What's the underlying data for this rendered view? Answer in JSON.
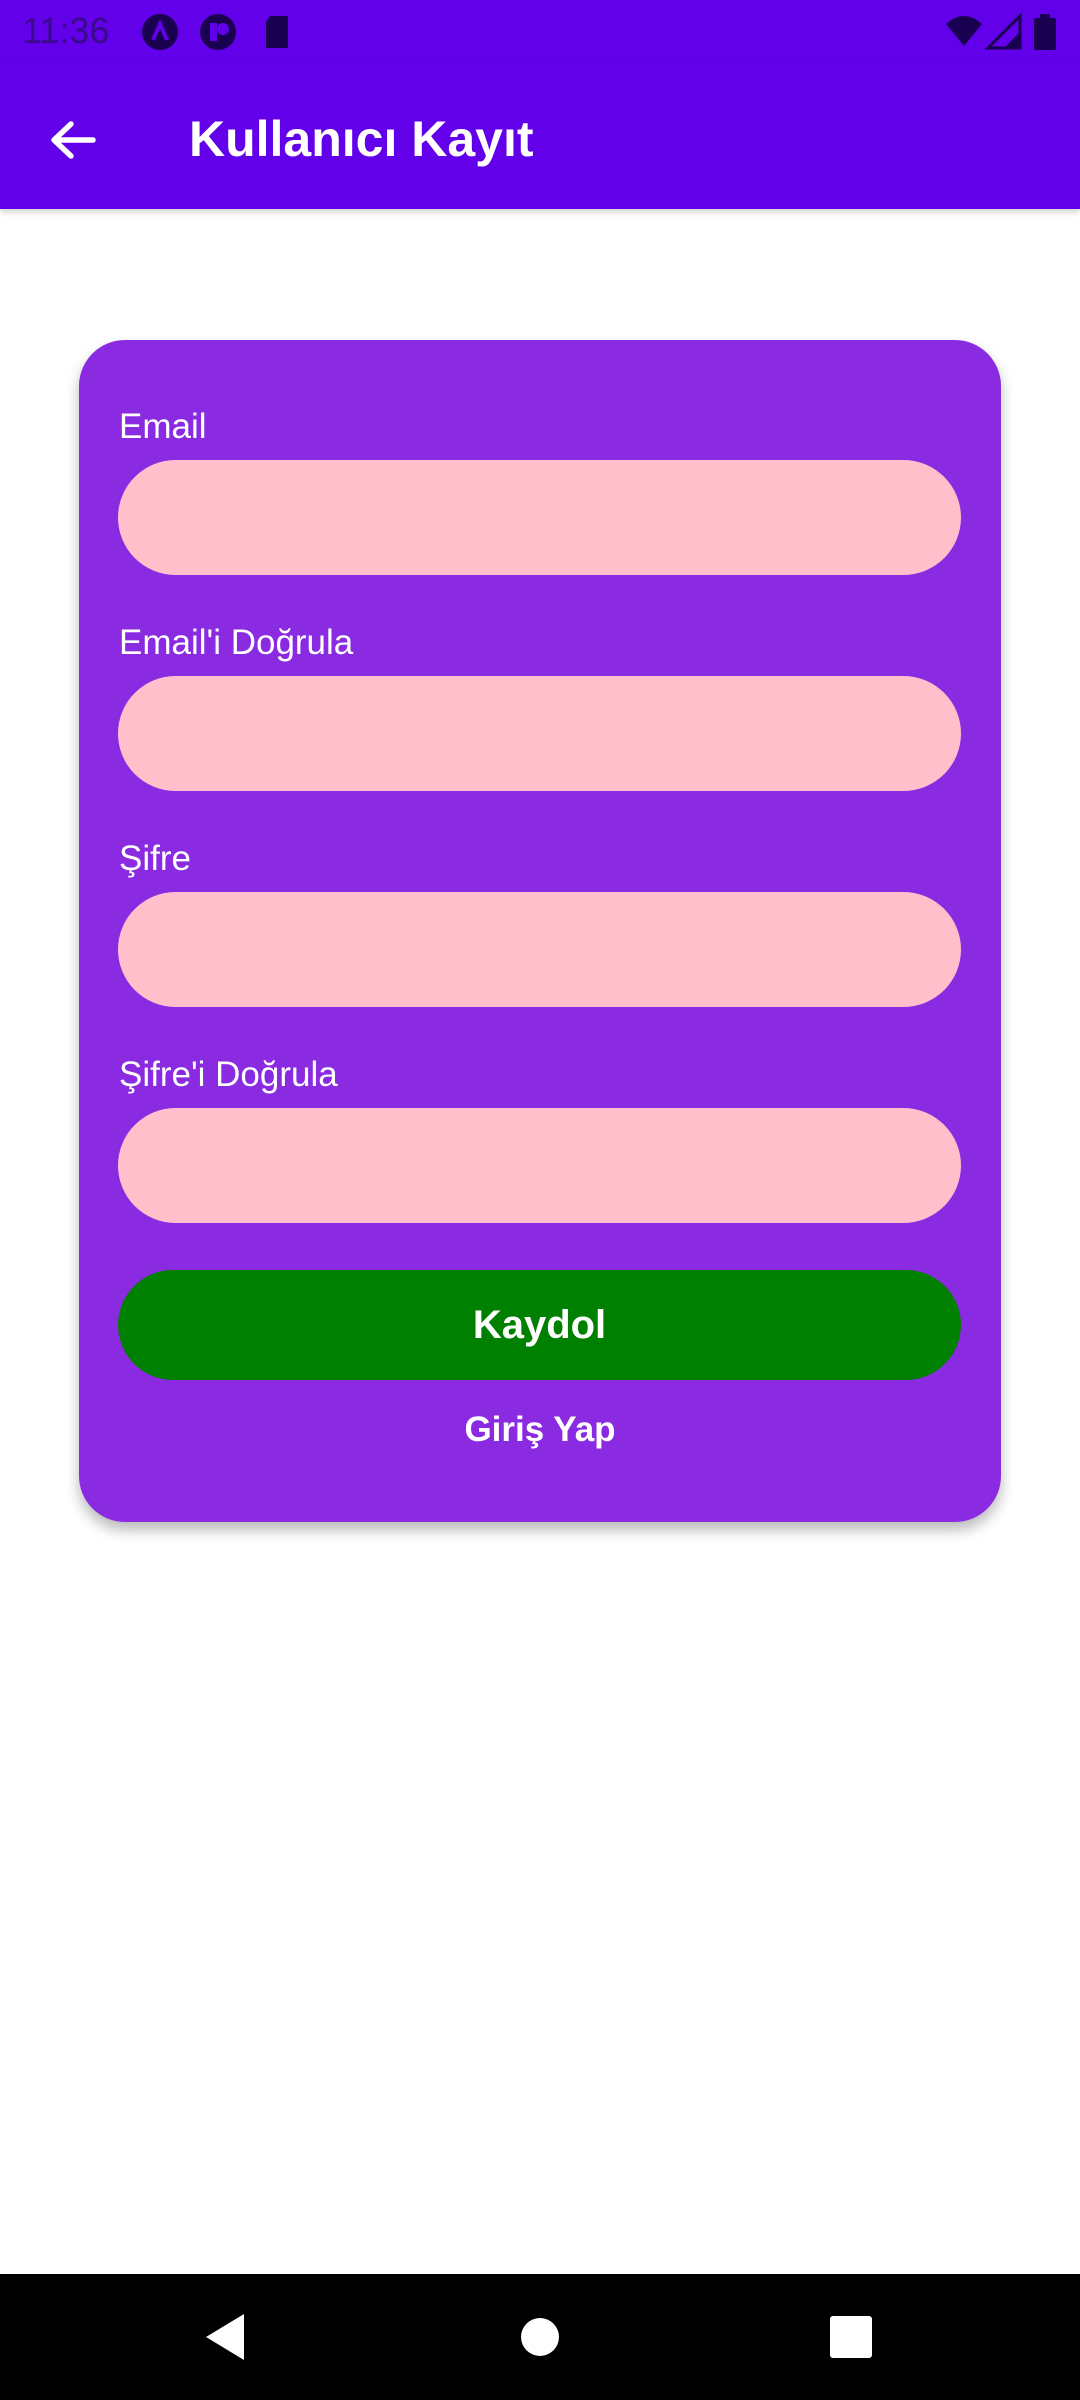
{
  "status_bar": {
    "time": "11:36",
    "left_icons": [
      "android-studio-icon",
      "notification-app-icon",
      "sd-card-icon"
    ],
    "right_icons": [
      "wifi-icon",
      "signal-icon",
      "battery-icon"
    ]
  },
  "app_bar": {
    "title": "Kullanıcı Kayıt",
    "back_icon": "arrow-back-icon"
  },
  "form": {
    "fields": [
      {
        "label": "Email",
        "value": "",
        "placeholder": ""
      },
      {
        "label": "Email'i Doğrula",
        "value": "",
        "placeholder": ""
      },
      {
        "label": "Şifre",
        "value": "",
        "placeholder": ""
      },
      {
        "label": "Şifre'i Doğrula",
        "value": "",
        "placeholder": ""
      }
    ],
    "submit_label": "Kaydol",
    "login_link": "Giriş Yap"
  },
  "nav_bar": {
    "icons": [
      "back-triangle-icon",
      "home-circle-icon",
      "recents-square-icon"
    ]
  },
  "colors": {
    "app_bar": "#6200ea",
    "card": "#8a2be2",
    "input": "#ffc0cb",
    "button": "#008000"
  }
}
